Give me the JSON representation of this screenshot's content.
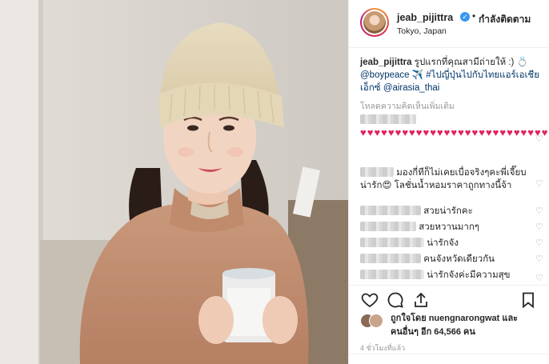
{
  "post": {
    "username": "jeab_pijittra",
    "follow_status": "กำลังติดตาม",
    "location": "Tokyo, Japan",
    "caption": {
      "username": "jeab_pijittra",
      "text_1": "รูปแรกที่คุณสามีถ่ายให้ :) 💍",
      "mention_1": "@boypeace",
      "text_2": " ✈️ ",
      "hashtag": "#ไปญี่ปุ่นไปกับไทยแอร์เอเชียเอ็กซ์",
      "mention_2": "@airasia_thai"
    },
    "load_more": "โหลดความคิดเห็นเพิ่มเติม"
  },
  "comments": [
    {
      "text": "♥♥♥♥♥♥♥♥♥♥♥♥♥♥♥♥♥♥♥♥♥♥♥♥♥♥♥♥♥♥"
    },
    {
      "text": "มองกี่ทีก็ไม่เคยเบื่อจริงๆคะพี่เจี๊ยบน่ารัก😍 โลชั่นน้ำหอมราคาถูกทางนี้จ้า"
    },
    {
      "text": "สวยน่ารักคะ"
    },
    {
      "text": "สวยหวานมากๆ"
    },
    {
      "text": "น่ารักจัง"
    },
    {
      "text": "คนจังหวัดเดียวกัน"
    },
    {
      "text": "น่ารักจังค่ะมีความสุข"
    }
  ],
  "likes": {
    "line_1": "ถูกใจโดย nuengnarongwat และ",
    "line_2": "คนอื่นๆ อีก 64,566 คน"
  },
  "time_ago": "4 ชั่วโมงที่แล้ว",
  "icons": [
    "verified-icon",
    "heart-icon",
    "comment-icon",
    "share-icon",
    "bookmark-icon"
  ]
}
